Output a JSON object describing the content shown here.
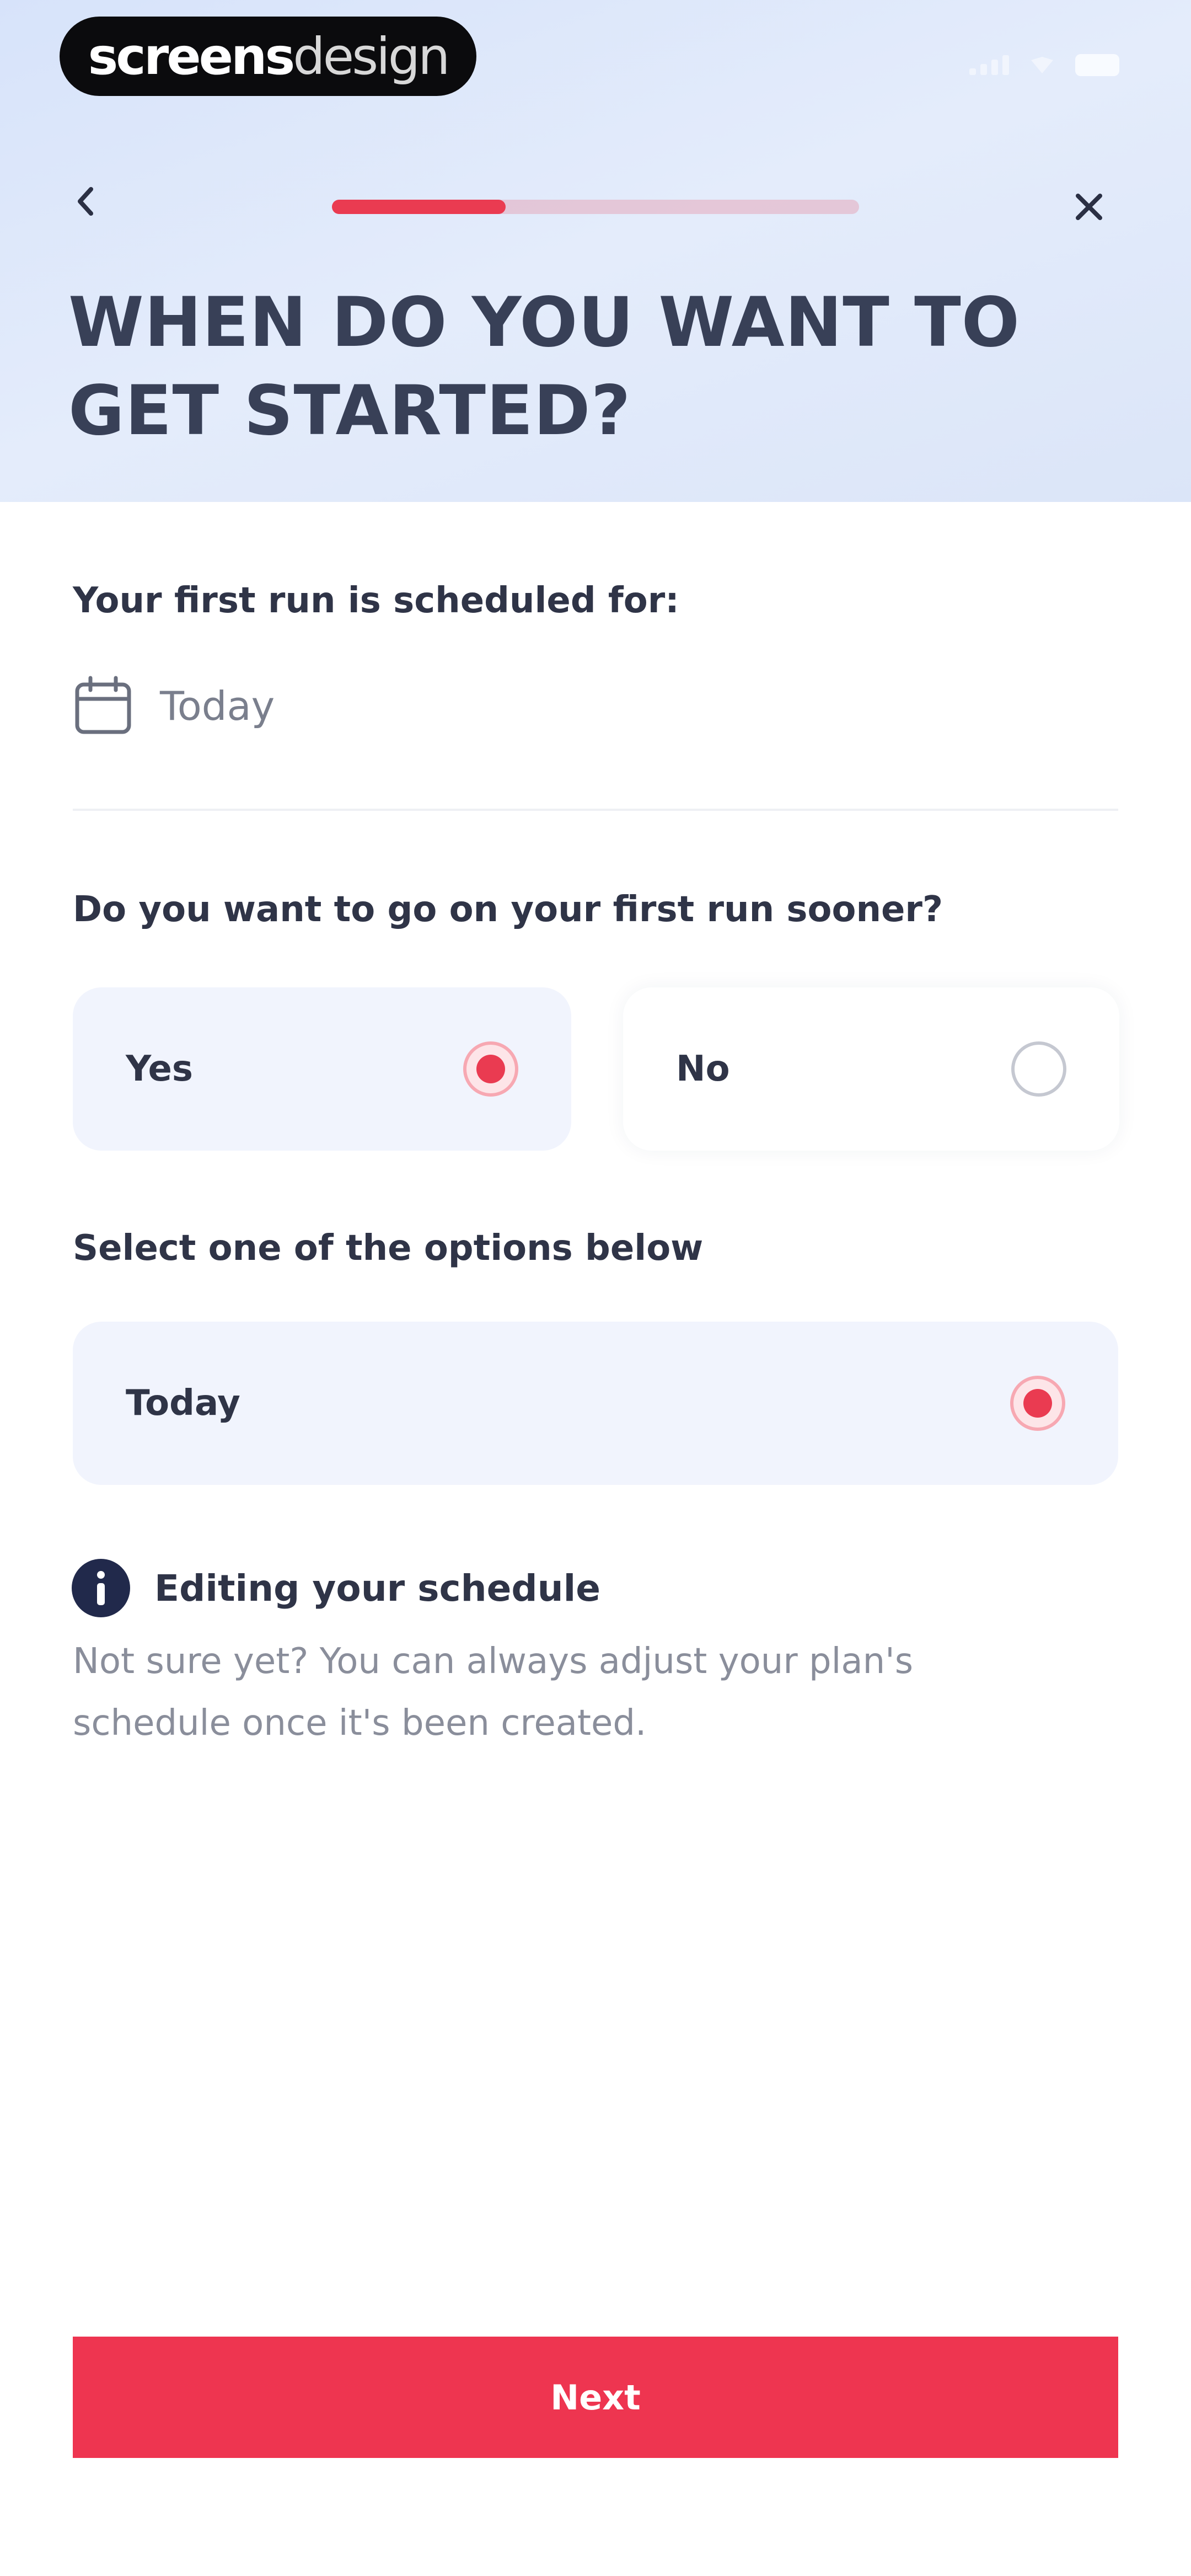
{
  "watermark": {
    "part_bold": "screens",
    "part_light": "design"
  },
  "header": {
    "title": "WHEN DO YOU WANT TO GET STARTED?",
    "progress_fraction": 0.33,
    "back_icon": "chevron-left-icon",
    "close_icon": "close-icon"
  },
  "schedule": {
    "label": "Your first run is scheduled for:",
    "value": "Today",
    "icon": "calendar-icon"
  },
  "sooner": {
    "question": "Do you want to go on your first run sooner?",
    "options": [
      {
        "label": "Yes",
        "selected": true
      },
      {
        "label": "No",
        "selected": false
      }
    ]
  },
  "start_options": {
    "label": "Select one of the options below",
    "options": [
      {
        "label": "Today",
        "selected": true
      }
    ]
  },
  "info": {
    "icon": "info-icon",
    "title": "Editing your schedule",
    "body": "Not sure yet? You can always adjust your plan's schedule once it's been created."
  },
  "footer": {
    "next_label": "Next"
  },
  "colors": {
    "accent": "#EA3B51",
    "header_bg": "#DCE6F9",
    "title_text": "#384057",
    "selected_option_bg": "#F1F4FD",
    "info_icon_bg": "#21294B"
  }
}
